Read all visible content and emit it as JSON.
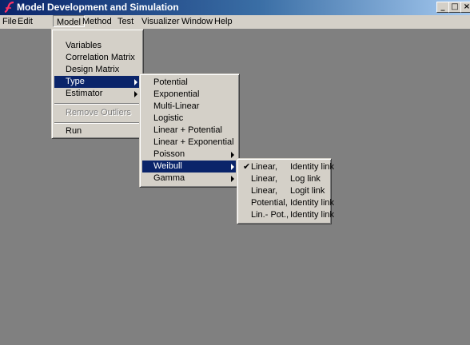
{
  "window": {
    "title": "Model Development and Simulation"
  },
  "title_buttons": {
    "minimize": "_",
    "maximize": "□",
    "close": "×"
  },
  "menubar": [
    "File",
    "Edit",
    "Model",
    "Method",
    "Test",
    "Visualizer",
    "Window",
    "Help"
  ],
  "model_menu": {
    "items": [
      "Variables",
      "Correlation Matrix",
      "Design Matrix",
      "Type",
      "Estimator",
      "Remove Outliers",
      "Run"
    ]
  },
  "type_menu": {
    "items": [
      "Potential",
      "Exponential",
      "Multi-Linear",
      "Logistic",
      "Linear + Potential",
      "Linear + Exponential",
      "Poisson",
      "Weibull",
      "Gamma"
    ]
  },
  "weibull_menu": {
    "items": [
      {
        "left": "Linear,",
        "right": "Identity link",
        "checked": true
      },
      {
        "left": "Linear,",
        "right": "Log link",
        "checked": false
      },
      {
        "left": "Linear,",
        "right": "Logit link",
        "checked": false
      },
      {
        "left": "Potential,",
        "right": "Identity link",
        "checked": false
      },
      {
        "left": "Lin.- Pot.,",
        "right": "Identity link",
        "checked": false
      }
    ],
    "check_glyph": "✔"
  },
  "colors": {
    "menu_bg": "#d4d0c8",
    "highlight": "#0a246a",
    "workspace": "#808080",
    "title_start": "#0a246a",
    "title_end": "#a6caf0"
  }
}
